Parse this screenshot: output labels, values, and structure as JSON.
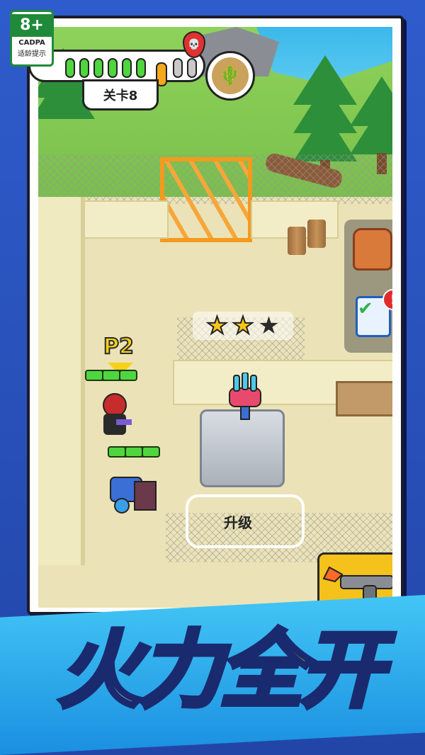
{
  "rating": {
    "age": "8+",
    "org": "CADPA",
    "tip": "适龄提示"
  },
  "hud": {
    "level_label": "关卡8",
    "progress": {
      "total": 10,
      "completed": 6,
      "current": 7
    },
    "boss_marker": "💀",
    "map_icon": "🌵"
  },
  "scene": {
    "stars": {
      "earned": 2,
      "total": 3
    },
    "player_tag": "P2",
    "upgrade_label": "升级"
  },
  "side_buttons": {
    "backpack": "backpack-icon",
    "tasks": "clipboard-check-icon",
    "task_alert": "!"
  },
  "banner": {
    "chars": [
      "火",
      "力",
      "全",
      "开"
    ]
  },
  "colors": {
    "accent": "#f4c21a",
    "banner": "#1a8fe0",
    "health": "#4fd63e",
    "gate": "#f49a1e"
  }
}
